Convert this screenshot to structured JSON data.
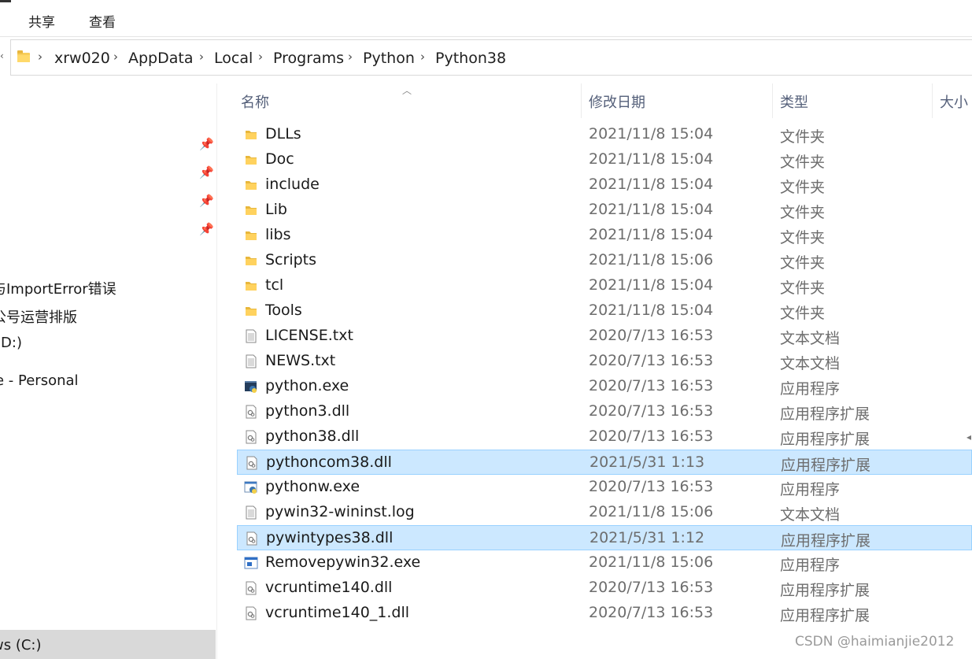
{
  "ribbon": {
    "tabs": [
      "共享",
      "查看"
    ]
  },
  "address": {
    "crumbs": [
      "xrw020",
      "AppData",
      "Local",
      "Programs",
      "Python",
      "Python38"
    ]
  },
  "nav": {
    "items": [
      "与ImportError错误",
      "公号运营排版",
      "(D:)",
      "e - Personal",
      "ws (C:)"
    ]
  },
  "columns": {
    "name": "名称",
    "date": "修改日期",
    "type": "类型",
    "size": "大小"
  },
  "files": [
    {
      "name": "DLLs",
      "date": "2021/11/8 15:04",
      "type": "文件夹",
      "icon": "folder-icon",
      "selected": false
    },
    {
      "name": "Doc",
      "date": "2021/11/8 15:04",
      "type": "文件夹",
      "icon": "folder-icon",
      "selected": false
    },
    {
      "name": "include",
      "date": "2021/11/8 15:04",
      "type": "文件夹",
      "icon": "folder-icon",
      "selected": false
    },
    {
      "name": "Lib",
      "date": "2021/11/8 15:04",
      "type": "文件夹",
      "icon": "folder-icon",
      "selected": false
    },
    {
      "name": "libs",
      "date": "2021/11/8 15:04",
      "type": "文件夹",
      "icon": "folder-icon",
      "selected": false
    },
    {
      "name": "Scripts",
      "date": "2021/11/8 15:06",
      "type": "文件夹",
      "icon": "folder-icon",
      "selected": false
    },
    {
      "name": "tcl",
      "date": "2021/11/8 15:04",
      "type": "文件夹",
      "icon": "folder-icon",
      "selected": false
    },
    {
      "name": "Tools",
      "date": "2021/11/8 15:04",
      "type": "文件夹",
      "icon": "folder-icon",
      "selected": false
    },
    {
      "name": "LICENSE.txt",
      "date": "2020/7/13 16:53",
      "type": "文本文档",
      "icon": "text-file-icon",
      "selected": false
    },
    {
      "name": "NEWS.txt",
      "date": "2020/7/13 16:53",
      "type": "文本文档",
      "icon": "text-file-icon",
      "selected": false
    },
    {
      "name": "python.exe",
      "date": "2020/7/13 16:53",
      "type": "应用程序",
      "icon": "python-exe-icon",
      "selected": false
    },
    {
      "name": "python3.dll",
      "date": "2020/7/13 16:53",
      "type": "应用程序扩展",
      "icon": "dll-file-icon",
      "selected": false
    },
    {
      "name": "python38.dll",
      "date": "2020/7/13 16:53",
      "type": "应用程序扩展",
      "icon": "dll-file-icon",
      "selected": false
    },
    {
      "name": "pythoncom38.dll",
      "date": "2021/5/31 1:13",
      "type": "应用程序扩展",
      "icon": "dll-file-icon",
      "selected": true
    },
    {
      "name": "pythonw.exe",
      "date": "2020/7/13 16:53",
      "type": "应用程序",
      "icon": "pythonw-exe-icon",
      "selected": false
    },
    {
      "name": "pywin32-wininst.log",
      "date": "2021/11/8 15:06",
      "type": "文本文档",
      "icon": "text-file-icon",
      "selected": false
    },
    {
      "name": "pywintypes38.dll",
      "date": "2021/5/31 1:12",
      "type": "应用程序扩展",
      "icon": "dll-file-icon",
      "selected": true
    },
    {
      "name": "Removepywin32.exe",
      "date": "2021/11/8 15:06",
      "type": "应用程序",
      "icon": "app-exe-icon",
      "selected": false
    },
    {
      "name": "vcruntime140.dll",
      "date": "2020/7/13 16:53",
      "type": "应用程序扩展",
      "icon": "dll-file-icon",
      "selected": false
    },
    {
      "name": "vcruntime140_1.dll",
      "date": "2020/7/13 16:53",
      "type": "应用程序扩展",
      "icon": "dll-file-icon",
      "selected": false
    }
  ],
  "watermark": "CSDN @haimianjie2012",
  "colors": {
    "selection": "#cce8ff",
    "selection_border": "#99d1ff",
    "folder": "#ffd96a"
  }
}
